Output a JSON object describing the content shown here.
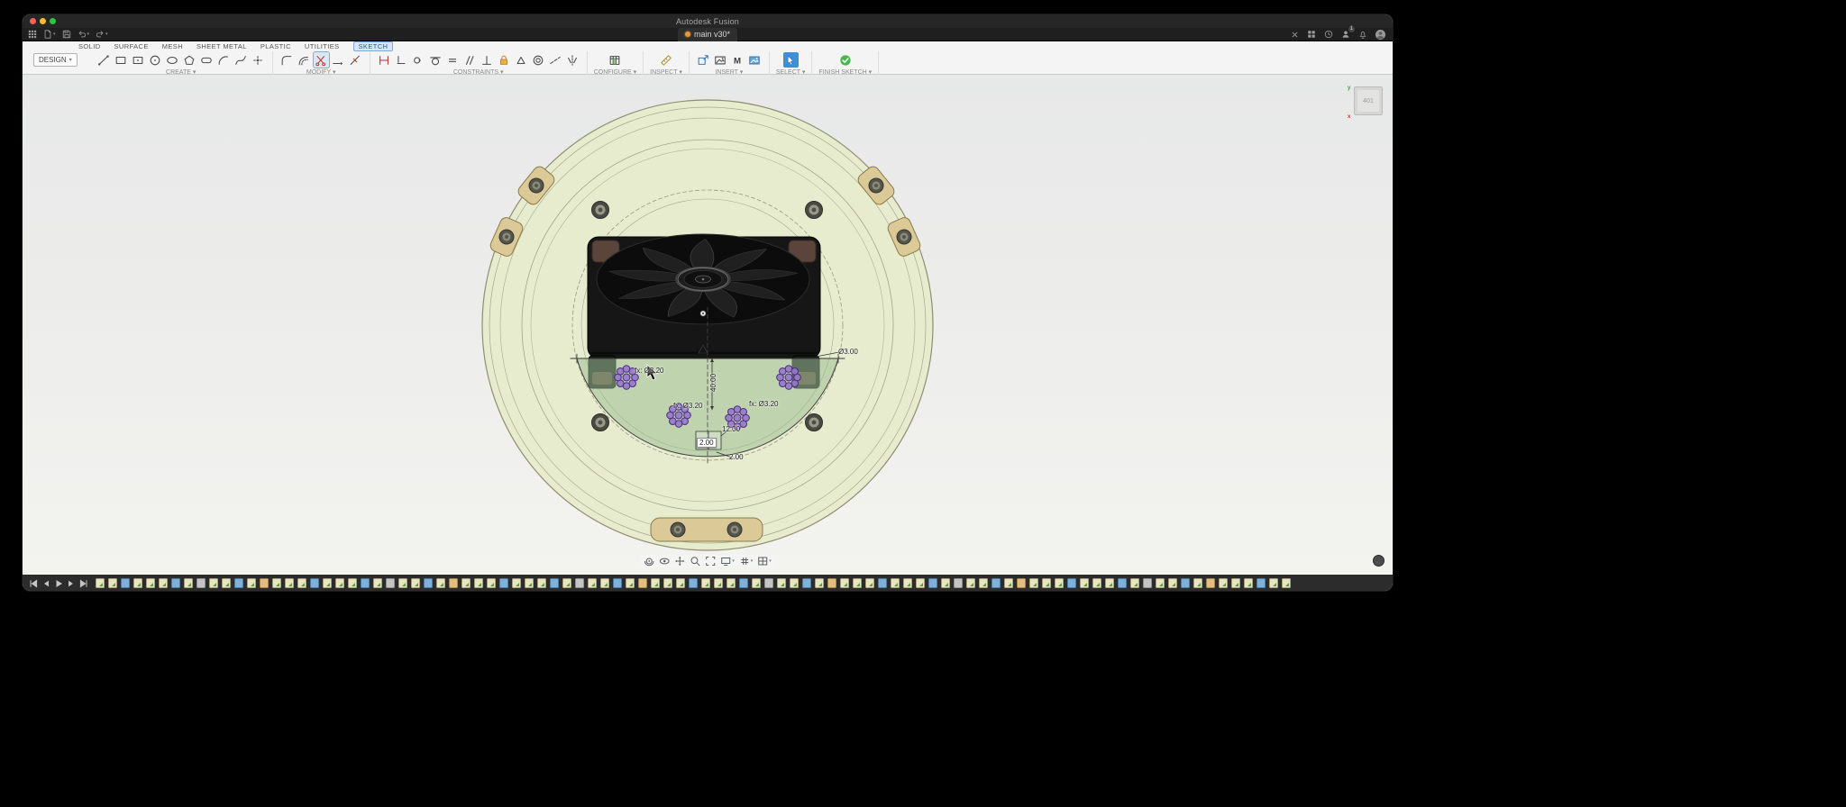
{
  "colors": {
    "accent-blue": "#3f8ed8",
    "ribbon-bg": "#f4f4f4",
    "timeline-bg": "#2c2c2c",
    "plate": "#e8ecce",
    "sketch-fill": "#9dbf96",
    "flower-purple": "#9678c8",
    "trim-red": "#c0392b",
    "lock-orange": "#d89a3a",
    "finish-green": "#49b84f"
  },
  "window": {
    "title": "Autodesk Fusion"
  },
  "docbar": {
    "tab_title": "main v30*",
    "collaborate_badge": "1"
  },
  "ribbon": {
    "file_menu_label": "DESIGN",
    "tabs": [
      {
        "label": "SOLID"
      },
      {
        "label": "SURFACE"
      },
      {
        "label": "MESH"
      },
      {
        "label": "SHEET METAL"
      },
      {
        "label": "PLASTIC"
      },
      {
        "label": "UTILITIES"
      },
      {
        "label": "SKETCH",
        "active": true
      }
    ],
    "groups": [
      {
        "label": "CREATE",
        "items": [
          {
            "icon": "line-icon"
          },
          {
            "icon": "rectangle-icon"
          },
          {
            "icon": "center-rectangle-icon"
          },
          {
            "icon": "circle-icon"
          },
          {
            "icon": "ellipse-icon"
          },
          {
            "icon": "polygon-icon"
          },
          {
            "icon": "slot-icon"
          },
          {
            "icon": "arc-icon"
          },
          {
            "icon": "spline-icon"
          },
          {
            "icon": "point-icon"
          }
        ]
      },
      {
        "label": "MODIFY",
        "items": [
          {
            "icon": "fillet-icon"
          },
          {
            "icon": "offset-icon"
          },
          {
            "icon": "trim-icon",
            "state": "active"
          },
          {
            "icon": "extend-icon"
          },
          {
            "icon": "break-icon"
          }
        ]
      },
      {
        "label": "CONSTRAINTS",
        "items": [
          {
            "icon": "sketch-dimension-icon"
          },
          {
            "icon": "horizontal-vertical-icon"
          },
          {
            "icon": "coincident-icon"
          },
          {
            "icon": "tangent-icon"
          },
          {
            "icon": "equal-icon"
          },
          {
            "icon": "parallel-icon"
          },
          {
            "icon": "perpendicular-icon"
          },
          {
            "icon": "fix-lock-icon"
          },
          {
            "icon": "midpoint-icon"
          },
          {
            "icon": "concentric-icon"
          },
          {
            "icon": "collinear-icon"
          },
          {
            "icon": "symmetry-icon"
          }
        ]
      },
      {
        "label": "CONFIGURE",
        "items": [
          {
            "icon": "configure-table-icon"
          }
        ]
      },
      {
        "label": "INSPECT",
        "items": [
          {
            "icon": "measure-icon"
          }
        ]
      },
      {
        "label": "INSERT",
        "items": [
          {
            "icon": "insert-derive-icon"
          },
          {
            "icon": "decal-icon"
          },
          {
            "icon": "mcmaster-icon"
          },
          {
            "icon": "canvas-icon"
          }
        ]
      },
      {
        "label": "SELECT",
        "items": [
          {
            "icon": "select-cursor-icon",
            "state": "select-active"
          }
        ]
      },
      {
        "label": "FINISH SKETCH",
        "items": [
          {
            "icon": "finish-sketch-icon"
          }
        ]
      }
    ]
  },
  "canvas": {
    "viewcube_label": "401",
    "axis_x_label": "x",
    "axis_y_label": "y",
    "dimensions": {
      "dia_right": "Ø3.00",
      "fx_left": "fx: Ø3.20",
      "fx_mid": "fx: Ø3.20",
      "fx_right": "fx: Ø3.20",
      "height": "40.00",
      "width": "12.00",
      "edit": "2.00",
      "radius": "2.00"
    }
  },
  "timeline": {
    "items": [
      "sketch",
      "sketch",
      "extrude",
      "sketch",
      "sketch",
      "sketch",
      "extrude",
      "sketch",
      "modify",
      "sketch",
      "sketch",
      "extrude",
      "sketch",
      "construct",
      "sketch",
      "sketch",
      "sketch",
      "extrude",
      "sketch",
      "sketch",
      "sketch",
      "extrude",
      "sketch",
      "modify",
      "sketch",
      "sketch",
      "extrude",
      "sketch",
      "construct",
      "sketch",
      "sketch",
      "sketch",
      "extrude",
      "sketch",
      "sketch",
      "sketch",
      "extrude",
      "sketch",
      "modify",
      "sketch",
      "sketch",
      "extrude",
      "sketch",
      "construct",
      "sketch",
      "sketch",
      "sketch",
      "extrude",
      "sketch",
      "sketch",
      "sketch",
      "extrude",
      "sketch",
      "modify",
      "sketch",
      "sketch",
      "extrude",
      "sketch",
      "construct",
      "sketch",
      "sketch",
      "sketch",
      "extrude",
      "sketch",
      "sketch",
      "sketch",
      "extrude",
      "sketch",
      "modify",
      "sketch",
      "sketch",
      "extrude",
      "sketch",
      "construct",
      "sketch",
      "sketch",
      "sketch",
      "extrude",
      "sketch",
      "sketch",
      "sketch",
      "extrude",
      "sketch",
      "modify",
      "sketch",
      "sketch",
      "extrude",
      "sketch",
      "construct",
      "sketch",
      "sketch",
      "sketch",
      "extrude",
      "sketch",
      "sketch"
    ]
  }
}
